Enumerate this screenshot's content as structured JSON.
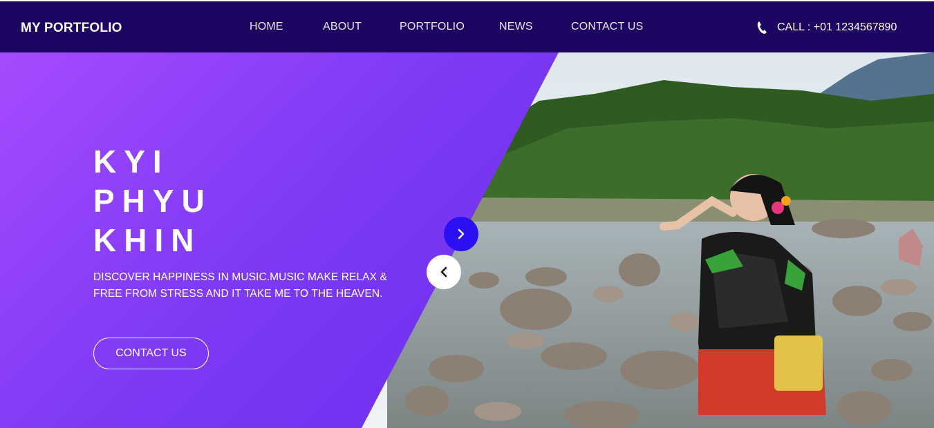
{
  "header": {
    "brand": "MY PORTFOLIO",
    "nav": [
      {
        "label": "HOME"
      },
      {
        "label": "ABOUT"
      },
      {
        "label": "PORTFOLIO"
      },
      {
        "label": "NEWS"
      },
      {
        "label": "CONTACT US"
      }
    ],
    "call_text": "CALL : +01 1234567890",
    "phone_icon": "phone-icon"
  },
  "hero": {
    "title_lines": [
      "KYI",
      "PHYU",
      "KHIN"
    ],
    "tagline_line1": "DISCOVER HAPPINESS IN MUSIC.MUSIC MAKE RELAX &",
    "tagline_line2": "FREE FROM STRESS AND IT TAKE ME TO THE HEAVEN.",
    "button_label": "CONTACT US",
    "next_icon": "chevron-right-icon",
    "prev_icon": "chevron-left-icon"
  },
  "colors": {
    "header_bg": "#1f0562",
    "hero_gradient_start": "#a64bff",
    "hero_gradient_end": "#6a2bee",
    "next_button": "#2a10f2",
    "prev_button": "#ffffff"
  }
}
